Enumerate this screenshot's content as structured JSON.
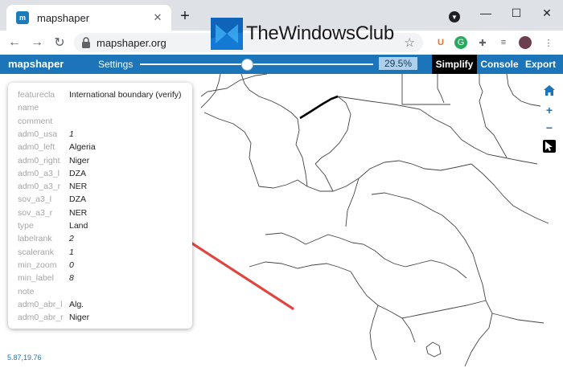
{
  "browser": {
    "tab_title": "mapshaper",
    "favicon_text": "m",
    "url": "mapshaper.org"
  },
  "watermark": {
    "text": "TheWindowsClub"
  },
  "app": {
    "logo": "mapshaper",
    "settings_label": "Settings",
    "simplify_percent": "29.5%",
    "simplify_fraction": 0.46,
    "buttons": {
      "simplify": "Simplify",
      "console": "Console",
      "export": "Export"
    },
    "accent_color": "#1b75b8"
  },
  "feature": {
    "rows": [
      {
        "key": "featurecla",
        "value": "International boundary (verify)",
        "numeric": false
      },
      {
        "key": "name",
        "value": "",
        "numeric": false
      },
      {
        "key": "comment",
        "value": "",
        "numeric": false
      },
      {
        "key": "adm0_usa",
        "value": "1",
        "numeric": true
      },
      {
        "key": "adm0_left",
        "value": "Algeria",
        "numeric": false
      },
      {
        "key": "adm0_right",
        "value": "Niger",
        "numeric": false
      },
      {
        "key": "adm0_a3_l",
        "value": "DZA",
        "numeric": false
      },
      {
        "key": "adm0_a3_r",
        "value": "NER",
        "numeric": false
      },
      {
        "key": "sov_a3_l",
        "value": "DZA",
        "numeric": false
      },
      {
        "key": "sov_a3_r",
        "value": "NER",
        "numeric": false
      },
      {
        "key": "type",
        "value": "Land",
        "numeric": false
      },
      {
        "key": "labelrank",
        "value": "2",
        "numeric": true
      },
      {
        "key": "scalerank",
        "value": "1",
        "numeric": true
      },
      {
        "key": "min_zoom",
        "value": "0",
        "numeric": true
      },
      {
        "key": "min_label",
        "value": "8",
        "numeric": true
      },
      {
        "key": "note",
        "value": "",
        "numeric": false
      },
      {
        "key": "adm0_abr_l",
        "value": "Alg.",
        "numeric": false
      },
      {
        "key": "adm0_abr_r",
        "value": "Niger",
        "numeric": false
      }
    ]
  },
  "coordinates": "5.87,19.76",
  "map_tools": [
    "home-icon",
    "zoom-in-icon",
    "zoom-out-icon",
    "pointer-icon"
  ]
}
